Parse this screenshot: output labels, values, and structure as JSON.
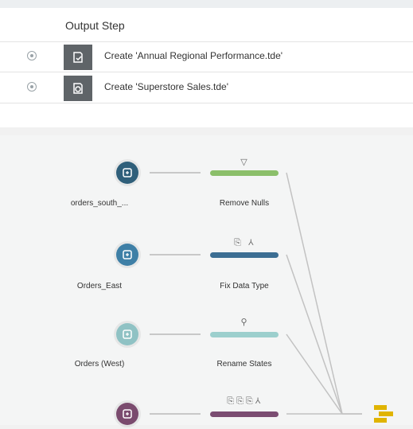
{
  "output_table": {
    "header": "Output Step",
    "rows": [
      {
        "text": "Create 'Annual Regional Performance.tde'"
      },
      {
        "text": "Create 'Superstore Sales.tde'"
      }
    ]
  },
  "flow": {
    "inputs": [
      {
        "label": "orders_south_...",
        "color": "#2f5f7a"
      },
      {
        "label": "Orders_East",
        "color": "#3e7fa6"
      },
      {
        "label": "Orders (West)",
        "color": "#8fc2c4"
      },
      {
        "label": "",
        "color": "#7a4b6e"
      }
    ],
    "steps": [
      {
        "label": "Remove Nulls",
        "color": "#8bbf6a",
        "icons": "▽"
      },
      {
        "label": "Fix Data Type",
        "color": "#3c6e93",
        "icons": "⎘ ⅄"
      },
      {
        "label": "Rename States",
        "color": "#9ccfcd",
        "icons": "⚲"
      },
      {
        "label": "",
        "color": "#7b4d72",
        "icons": "⎘⎘⎘⅄"
      }
    ],
    "union_color": "#e0b400"
  }
}
